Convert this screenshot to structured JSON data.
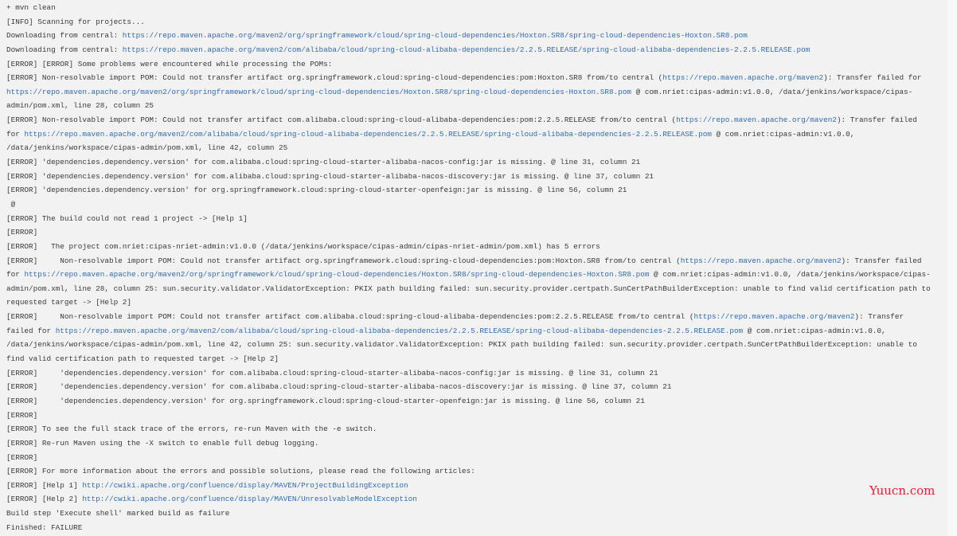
{
  "colors": {
    "text": "#3a3a3a",
    "link": "#2e6bb8",
    "background": "#f2f2f3",
    "watermark": "#f0182f"
  },
  "watermark": "Yuucn.com",
  "lines": [
    [
      {
        "t": "+ mvn clean"
      }
    ],
    [
      {
        "t": "[INFO] Scanning for projects..."
      }
    ],
    [
      {
        "t": "Downloading from central: "
      },
      {
        "t": "https://repo.maven.apache.org/maven2/org/springframework/cloud/spring-cloud-dependencies/Hoxton.SR8/spring-cloud-dependencies-Hoxton.SR8.pom",
        "link": true
      }
    ],
    [
      {
        "t": "Downloading from central: "
      },
      {
        "t": "https://repo.maven.apache.org/maven2/com/alibaba/cloud/spring-cloud-alibaba-dependencies/2.2.5.RELEASE/spring-cloud-alibaba-dependencies-2.2.5.RELEASE.pom",
        "link": true
      }
    ],
    [
      {
        "t": "[ERROR] [ERROR] Some problems were encountered while processing the POMs:"
      }
    ],
    [
      {
        "t": "[ERROR] Non-resolvable import POM: Could not transfer artifact org.springframework.cloud:spring-cloud-dependencies:pom:Hoxton.SR8 from/to central ("
      },
      {
        "t": "https://repo.maven.apache.org/maven2",
        "link": true
      },
      {
        "t": "): Transfer failed for"
      }
    ],
    [
      {
        "t": "https://repo.maven.apache.org/maven2/org/springframework/cloud/spring-cloud-dependencies/Hoxton.SR8/spring-cloud-dependencies-Hoxton.SR8.pom",
        "link": true
      },
      {
        "t": " @ com.nriet:cipas-admin:v1.0.0, /data/jenkins/workspace/cipas-"
      }
    ],
    [
      {
        "t": "admin/pom.xml, line 28, column 25"
      }
    ],
    [
      {
        "t": "[ERROR] Non-resolvable import POM: Could not transfer artifact com.alibaba.cloud:spring-cloud-alibaba-dependencies:pom:2.2.5.RELEASE from/to central ("
      },
      {
        "t": "https://repo.maven.apache.org/maven2",
        "link": true
      },
      {
        "t": "): Transfer failed"
      }
    ],
    [
      {
        "t": "for "
      },
      {
        "t": "https://repo.maven.apache.org/maven2/com/alibaba/cloud/spring-cloud-alibaba-dependencies/2.2.5.RELEASE/spring-cloud-alibaba-dependencies-2.2.5.RELEASE.pom",
        "link": true
      },
      {
        "t": " @ com.nriet:cipas-admin:v1.0.0,"
      }
    ],
    [
      {
        "t": "/data/jenkins/workspace/cipas-admin/pom.xml, line 42, column 25"
      }
    ],
    [
      {
        "t": "[ERROR] 'dependencies.dependency.version' for com.alibaba.cloud:spring-cloud-starter-alibaba-nacos-config:jar is missing. @ line 31, column 21"
      }
    ],
    [
      {
        "t": "[ERROR] 'dependencies.dependency.version' for com.alibaba.cloud:spring-cloud-starter-alibaba-nacos-discovery:jar is missing. @ line 37, column 21"
      }
    ],
    [
      {
        "t": "[ERROR] 'dependencies.dependency.version' for org.springframework.cloud:spring-cloud-starter-openfeign:jar is missing. @ line 56, column 21"
      }
    ],
    [
      {
        "t": " @"
      }
    ],
    [
      {
        "t": "[ERROR] The build could not read 1 project -> [Help 1]"
      }
    ],
    [
      {
        "t": "[ERROR]"
      }
    ],
    [
      {
        "t": "[ERROR]   The project com.nriet:cipas-nriet-admin:v1.0.0 (/data/jenkins/workspace/cipas-admin/cipas-nriet-admin/pom.xml) has 5 errors"
      }
    ],
    [
      {
        "t": "[ERROR]     Non-resolvable import POM: Could not transfer artifact org.springframework.cloud:spring-cloud-dependencies:pom:Hoxton.SR8 from/to central ("
      },
      {
        "t": "https://repo.maven.apache.org/maven2",
        "link": true
      },
      {
        "t": "): Transfer failed"
      }
    ],
    [
      {
        "t": "for "
      },
      {
        "t": "https://repo.maven.apache.org/maven2/org/springframework/cloud/spring-cloud-dependencies/Hoxton.SR8/spring-cloud-dependencies-Hoxton.SR8.pom",
        "link": true
      },
      {
        "t": " @ com.nriet:cipas-admin:v1.0.0, /data/jenkins/workspace/cipas-"
      }
    ],
    [
      {
        "t": "admin/pom.xml, line 28, column 25: sun.security.validator.ValidatorException: PKIX path building failed: sun.security.provider.certpath.SunCertPathBuilderException: unable to find valid certification path to"
      }
    ],
    [
      {
        "t": "requested target -> [Help 2]"
      }
    ],
    [
      {
        "t": "[ERROR]     Non-resolvable import POM: Could not transfer artifact com.alibaba.cloud:spring-cloud-alibaba-dependencies:pom:2.2.5.RELEASE from/to central ("
      },
      {
        "t": "https://repo.maven.apache.org/maven2",
        "link": true
      },
      {
        "t": "): Transfer"
      }
    ],
    [
      {
        "t": "failed for "
      },
      {
        "t": "https://repo.maven.apache.org/maven2/com/alibaba/cloud/spring-cloud-alibaba-dependencies/2.2.5.RELEASE/spring-cloud-alibaba-dependencies-2.2.5.RELEASE.pom",
        "link": true
      },
      {
        "t": " @ com.nriet:cipas-admin:v1.0.0,"
      }
    ],
    [
      {
        "t": "/data/jenkins/workspace/cipas-admin/pom.xml, line 42, column 25: sun.security.validator.ValidatorException: PKIX path building failed: sun.security.provider.certpath.SunCertPathBuilderException: unable to"
      }
    ],
    [
      {
        "t": "find valid certification path to requested target -> [Help 2]"
      }
    ],
    [
      {
        "t": "[ERROR]     'dependencies.dependency.version' for com.alibaba.cloud:spring-cloud-starter-alibaba-nacos-config:jar is missing. @ line 31, column 21"
      }
    ],
    [
      {
        "t": "[ERROR]     'dependencies.dependency.version' for com.alibaba.cloud:spring-cloud-starter-alibaba-nacos-discovery:jar is missing. @ line 37, column 21"
      }
    ],
    [
      {
        "t": "[ERROR]     'dependencies.dependency.version' for org.springframework.cloud:spring-cloud-starter-openfeign:jar is missing. @ line 56, column 21"
      }
    ],
    [
      {
        "t": "[ERROR]"
      }
    ],
    [
      {
        "t": "[ERROR] To see the full stack trace of the errors, re-run Maven with the -e switch."
      }
    ],
    [
      {
        "t": "[ERROR] Re-run Maven using the -X switch to enable full debug logging."
      }
    ],
    [
      {
        "t": "[ERROR]"
      }
    ],
    [
      {
        "t": "[ERROR] For more information about the errors and possible solutions, please read the following articles:"
      }
    ],
    [
      {
        "t": "[ERROR] [Help 1] "
      },
      {
        "t": "http://cwiki.apache.org/confluence/display/MAVEN/ProjectBuildingException",
        "link": true
      }
    ],
    [
      {
        "t": "[ERROR] [Help 2] "
      },
      {
        "t": "http://cwiki.apache.org/confluence/display/MAVEN/UnresolvableModelException",
        "link": true
      }
    ],
    [
      {
        "t": "Build step 'Execute shell' marked build as failure"
      }
    ],
    [
      {
        "t": "Finished: FAILURE"
      }
    ]
  ]
}
